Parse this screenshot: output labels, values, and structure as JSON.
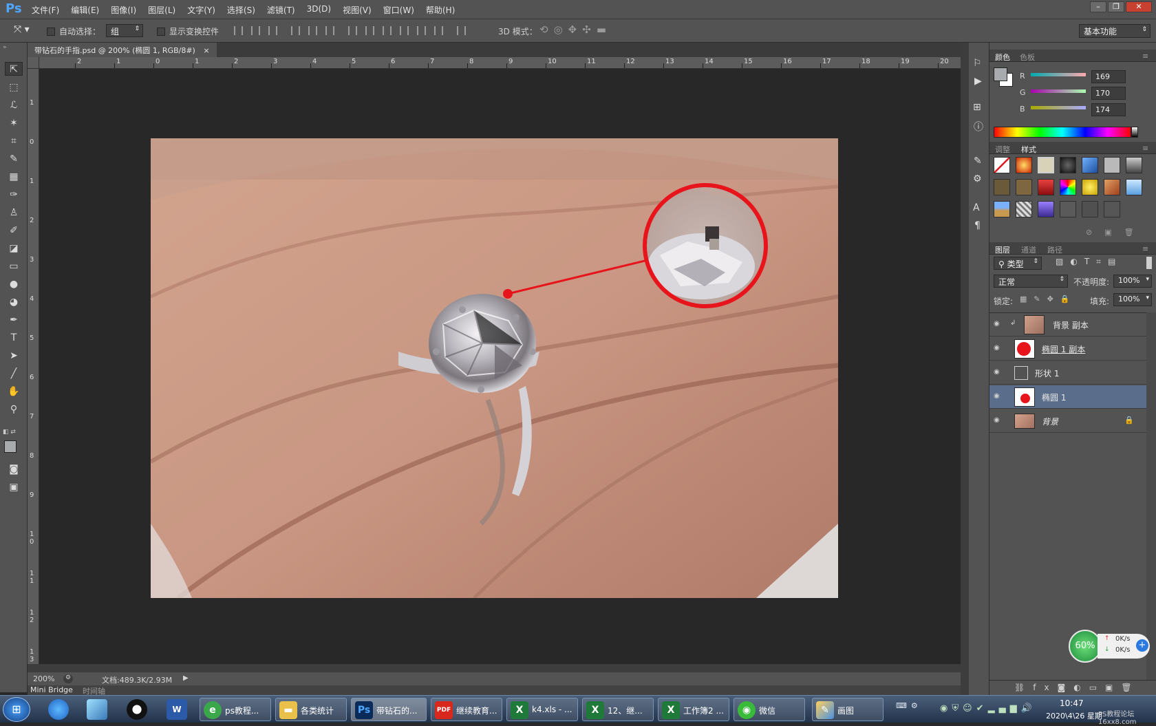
{
  "app": {
    "logo": "Ps"
  },
  "menu": [
    "文件(F)",
    "编辑(E)",
    "图像(I)",
    "图层(L)",
    "文字(Y)",
    "选择(S)",
    "滤镜(T)",
    "3D(D)",
    "视图(V)",
    "窗口(W)",
    "帮助(H)"
  ],
  "options": {
    "auto_select_label": "自动选择：",
    "auto_select_value": "组",
    "show_transform_label": "显示变换控件",
    "mode_3d_label": "3D 模式：",
    "workspace": "基本功能"
  },
  "document_tab": {
    "title": "带钻石的手指.psd @ 200% (椭圆 1, RGB/8#)",
    "close": "×"
  },
  "ruler_top": [
    "2",
    "1",
    "0",
    "1",
    "2",
    "3",
    "4",
    "5",
    "6",
    "7",
    "8",
    "9",
    "10",
    "11",
    "12",
    "13",
    "14",
    "15",
    "16",
    "17",
    "18",
    "19",
    "20"
  ],
  "ruler_left": [
    "1",
    "0",
    "1",
    "2",
    "3",
    "4",
    "5",
    "6",
    "7",
    "8",
    "9",
    "1 0",
    "1 1",
    "1 2",
    "1 3"
  ],
  "status": {
    "zoom": "200%",
    "doc_info": "文档:489.3K/2.93M"
  },
  "bottom_tabs": [
    "Mini Bridge",
    "时间轴"
  ],
  "color_panel": {
    "tabs": [
      "颜色",
      "色板"
    ],
    "channels": [
      {
        "label": "R",
        "value": "169"
      },
      {
        "label": "G",
        "value": "170"
      },
      {
        "label": "B",
        "value": "174"
      }
    ]
  },
  "styles_panel": {
    "tabs": [
      "调整",
      "样式"
    ]
  },
  "layers_panel": {
    "tabs": [
      "图层",
      "通道",
      "路径"
    ],
    "filter_kind": "类型",
    "blend_mode": "正常",
    "opacity_label": "不透明度:",
    "opacity_value": "100%",
    "lock_label": "锁定:",
    "fill_label": "填充:",
    "fill_value": "100%",
    "layers": [
      {
        "name": "背景 副本"
      },
      {
        "name": "椭圆 1 副本"
      },
      {
        "name": "形状 1"
      },
      {
        "name": "椭圆 1"
      },
      {
        "name": "背景"
      }
    ]
  },
  "net_widget": {
    "percent": "60%",
    "up": "0K/s",
    "down": "0K/s"
  },
  "taskbar": {
    "buttons": [
      {
        "label": "ps教程..."
      },
      {
        "label": "各类统计"
      },
      {
        "label": "带钻石的..."
      },
      {
        "label": "继续教育..."
      },
      {
        "label": "k4.xls - ..."
      },
      {
        "label": "12、继..."
      },
      {
        "label": "工作簿2 ..."
      },
      {
        "label": "微信"
      },
      {
        "label": "画图"
      }
    ],
    "clock_time": "10:47",
    "clock_date": "2020\\4\\26 星期",
    "watermark": "PS教程论坛 16xx8.com"
  },
  "colors": {
    "accent_red": "#e8141c",
    "panel_bg": "#535353",
    "canvas_bg": "#282828",
    "selected_layer": "#5a6d8a"
  }
}
